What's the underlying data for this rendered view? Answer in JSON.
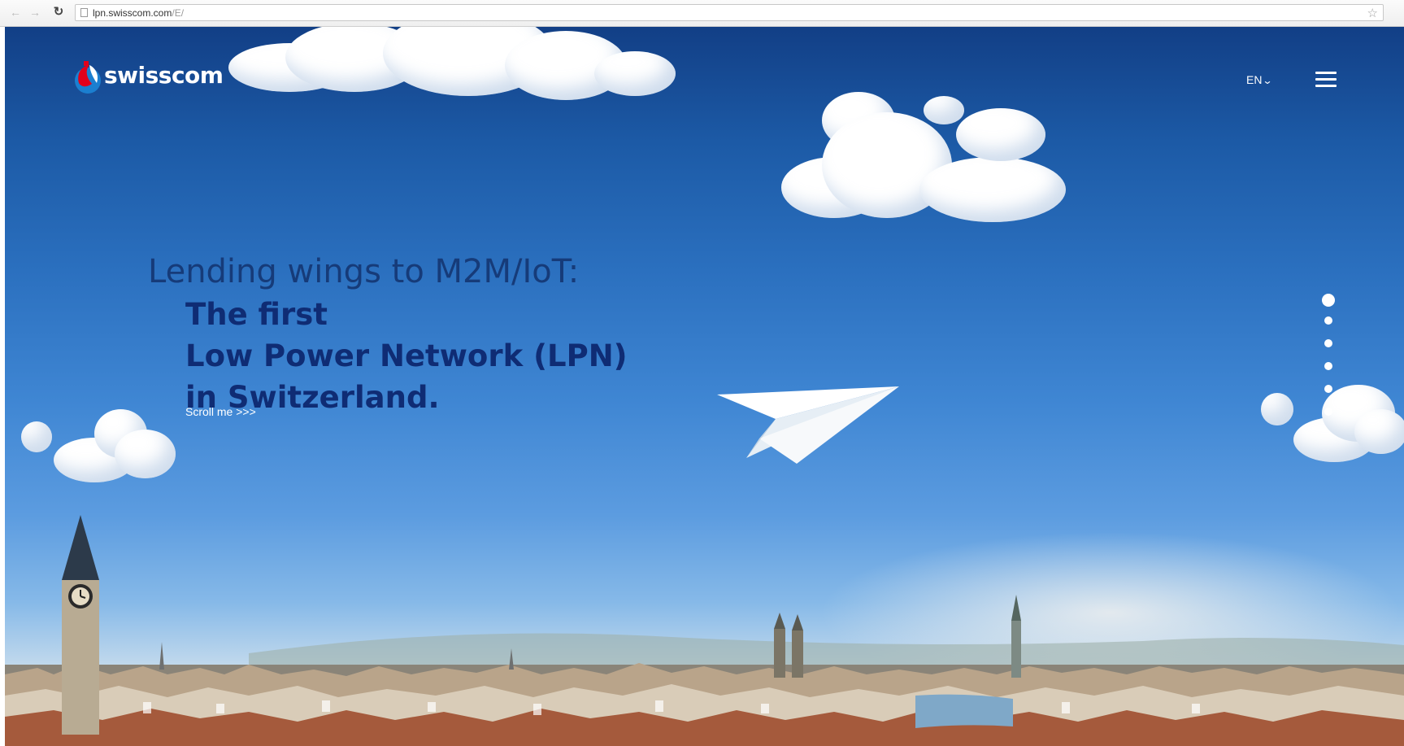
{
  "browser": {
    "url_host": "lpn.swisscom.com",
    "url_path": "/E/",
    "icons": [
      "back-icon",
      "forward-icon",
      "reload-icon",
      "page-icon",
      "star-icon"
    ]
  },
  "header": {
    "logo_text": "swisscom",
    "language": "EN",
    "icons": [
      "swisscom-logo-icon",
      "chevron-down-icon",
      "hamburger-menu-icon"
    ]
  },
  "hero": {
    "headline": "Lending wings to M2M/IoT:",
    "subheadline": [
      "The first",
      "Low Power Network (LPN)",
      "in Switzerland."
    ],
    "scroll_label": "Scroll me >>>",
    "slide_count": 6,
    "active_slide": 1,
    "illustration": "paper-plane"
  },
  "colors": {
    "sky_top": "#123f86",
    "sky_bottom": "#dbe6ec",
    "headline": "#163b79",
    "subheadline": "#0f2c74",
    "brand_red": "#e2001a"
  }
}
